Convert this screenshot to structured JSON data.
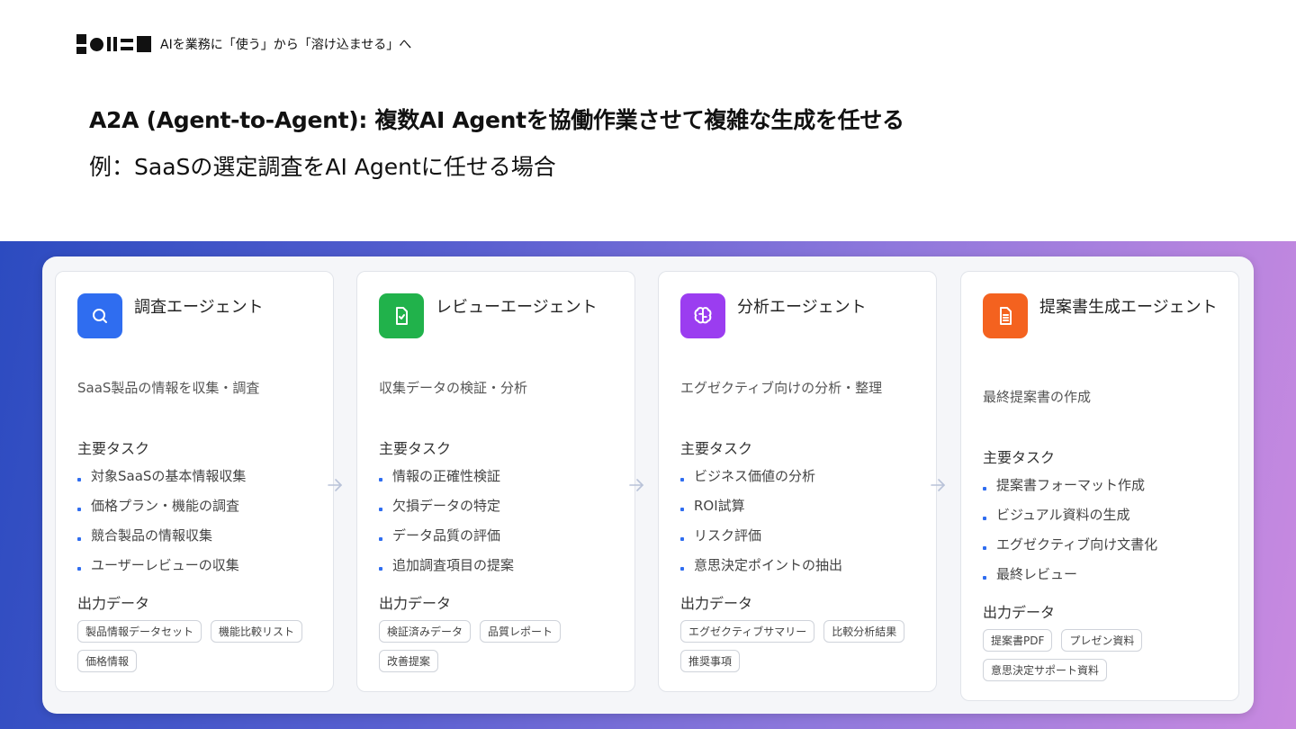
{
  "header": {
    "text": "AIを業務に「使う」から「溶け込ませる」へ"
  },
  "title": "A2A (Agent-to-Agent): 複数AI Agentを協働作業させて複雑な生成を任せる",
  "subtitle": "例：SaaSの選定調査をAI Agentに任せる場合",
  "labels": {
    "tasks": "主要タスク",
    "output": "出力データ"
  },
  "colors": {
    "blue": "#2f6df0",
    "green": "#21b24b",
    "purple": "#9b3df0",
    "orange": "#f4621f"
  },
  "cards": [
    {
      "icon": "search-icon",
      "title": "調査エージェント",
      "desc": "SaaS製品の情報を収集・調査",
      "tasks": [
        "対象SaaSの基本情報収集",
        "価格プラン・機能の調査",
        "競合製品の情報収集",
        "ユーザーレビューの収集"
      ],
      "tags": [
        "製品情報データセット",
        "機能比較リスト",
        "価格情報"
      ]
    },
    {
      "icon": "file-check-icon",
      "title": "レビューエージェント",
      "desc": "収集データの検証・分析",
      "tasks": [
        "情報の正確性検証",
        "欠損データの特定",
        "データ品質の評価",
        "追加調査項目の提案"
      ],
      "tags": [
        "検証済みデータ",
        "品質レポート",
        "改善提案"
      ]
    },
    {
      "icon": "brain-icon",
      "title": "分析エージェント",
      "desc": "エグゼクティブ向けの分析・整理",
      "tasks": [
        "ビジネス価値の分析",
        "ROI試算",
        "リスク評価",
        "意思決定ポイントの抽出"
      ],
      "tags": [
        "エグゼクティブサマリー",
        "比較分析結果",
        "推奨事項"
      ]
    },
    {
      "icon": "document-icon",
      "title": "提案書生成エージェント",
      "desc": "最終提案書の作成",
      "tasks": [
        "提案書フォーマット作成",
        "ビジュアル資料の生成",
        "エグゼクティブ向け文書化",
        "最終レビュー"
      ],
      "tags": [
        "提案書PDF",
        "プレゼン資料",
        "意思決定サポート資料"
      ]
    }
  ]
}
